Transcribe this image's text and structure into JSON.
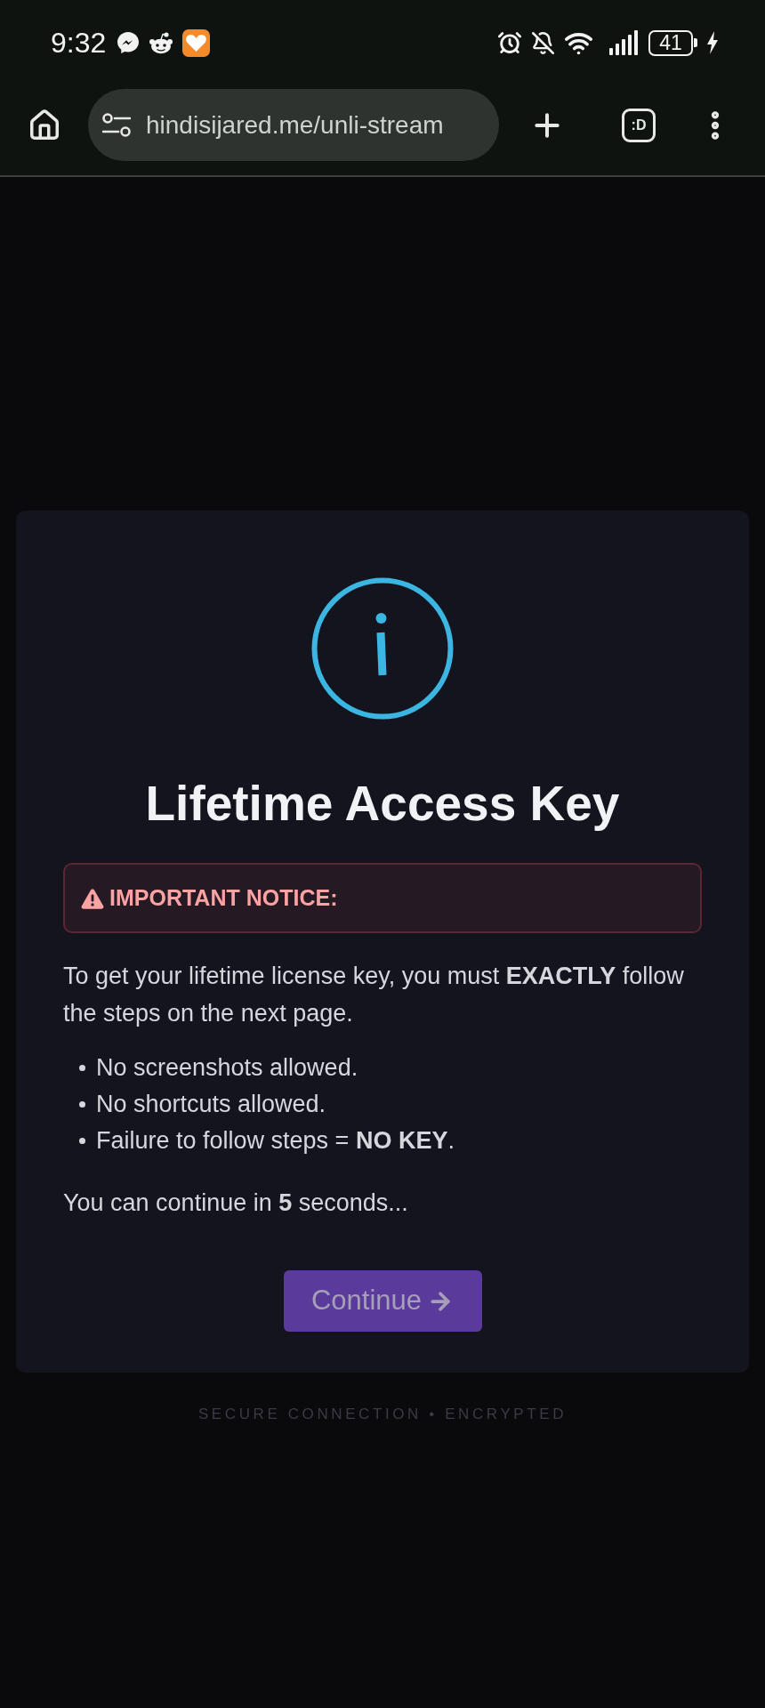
{
  "status_bar": {
    "time": "9:32",
    "battery": "41",
    "charging": true
  },
  "browser_bar": {
    "url": "hindisijared.me/unli-stream",
    "tab_switcher": ":D"
  },
  "dialog": {
    "title": "Lifetime Access Key",
    "notice": "IMPORTANT NOTICE:",
    "intro": "To get your lifetime license key, you must **EXACTLY** follow the steps on the next page.",
    "rules": [
      "No screenshots allowed.",
      "No shortcuts allowed.",
      "Failure to follow steps = **NO KEY**."
    ],
    "countdown": "You can continue in **5** seconds...",
    "button": {
      "label": "Continue",
      "disabled": true
    }
  },
  "footer": "SECURE CONNECTION • ENCRYPTED"
}
